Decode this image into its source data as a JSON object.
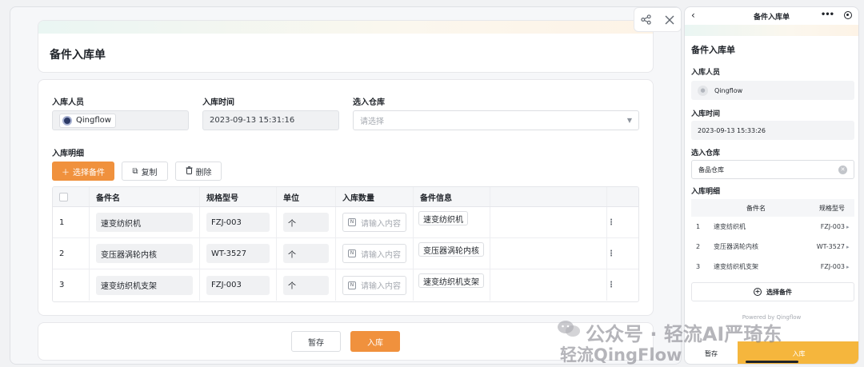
{
  "desktop": {
    "form_title": "备件入库单",
    "fields": {
      "person_label": "入库人员",
      "person_value": "Qingflow",
      "time_label": "入库时间",
      "time_value": "2023-09-13 15:31:16",
      "warehouse_label": "选入仓库",
      "warehouse_placeholder": "请选择"
    },
    "detail_label": "入库明细",
    "toolbar": {
      "select_label": "选择备件",
      "copy_label": "复制",
      "delete_label": "删除"
    },
    "table": {
      "columns": [
        "",
        "备件名",
        "规格型号",
        "单位",
        "入库数量",
        "备件信息",
        ""
      ],
      "rows": [
        {
          "index": "1",
          "name": "速变纺织机",
          "model": "FZJ-003",
          "unit": "个",
          "qty_placeholder": "请输入内容",
          "info": "速变纺织机"
        },
        {
          "index": "2",
          "name": "变压器涡轮内核",
          "model": "WT-3527",
          "unit": "个",
          "qty_placeholder": "请输入内容",
          "info": "变压器涡轮内核"
        },
        {
          "index": "3",
          "name": "速变纺织机支架",
          "model": "FZJ-003",
          "unit": "个",
          "qty_placeholder": "请输入内容",
          "info": "速变纺织机支架"
        }
      ]
    },
    "footer": {
      "save_label": "暂存",
      "submit_label": "入库"
    }
  },
  "mobile": {
    "nav_title": "备件入库单",
    "form_title": "备件入库单",
    "person_label": "入库人员",
    "person_value": "Qingflow",
    "time_label": "入库时间",
    "time_value": "2023-09-13 15:33:26",
    "warehouse_label": "选入仓库",
    "warehouse_value": "备品仓库",
    "detail_label": "入库明细",
    "table_columns": [
      "备件名",
      "规格型号"
    ],
    "rows": [
      {
        "index": "1",
        "name": "速变纺织机",
        "model": "FZJ-003"
      },
      {
        "index": "2",
        "name": "变压器涡轮内核",
        "model": "WT-3527"
      },
      {
        "index": "3",
        "name": "速变纺织机支架",
        "model": "FZJ-003"
      }
    ],
    "add_label": "选择备件",
    "powered": "Powered by Qingflow",
    "save_label": "暂存",
    "submit_label": "入库"
  },
  "watermark": {
    "line1": "公众号 · 轻流AI严琦东",
    "line2": "轻流QingFlow"
  },
  "colors": {
    "accent": "#f0913d",
    "mobile_submit": "#f5b63d"
  }
}
